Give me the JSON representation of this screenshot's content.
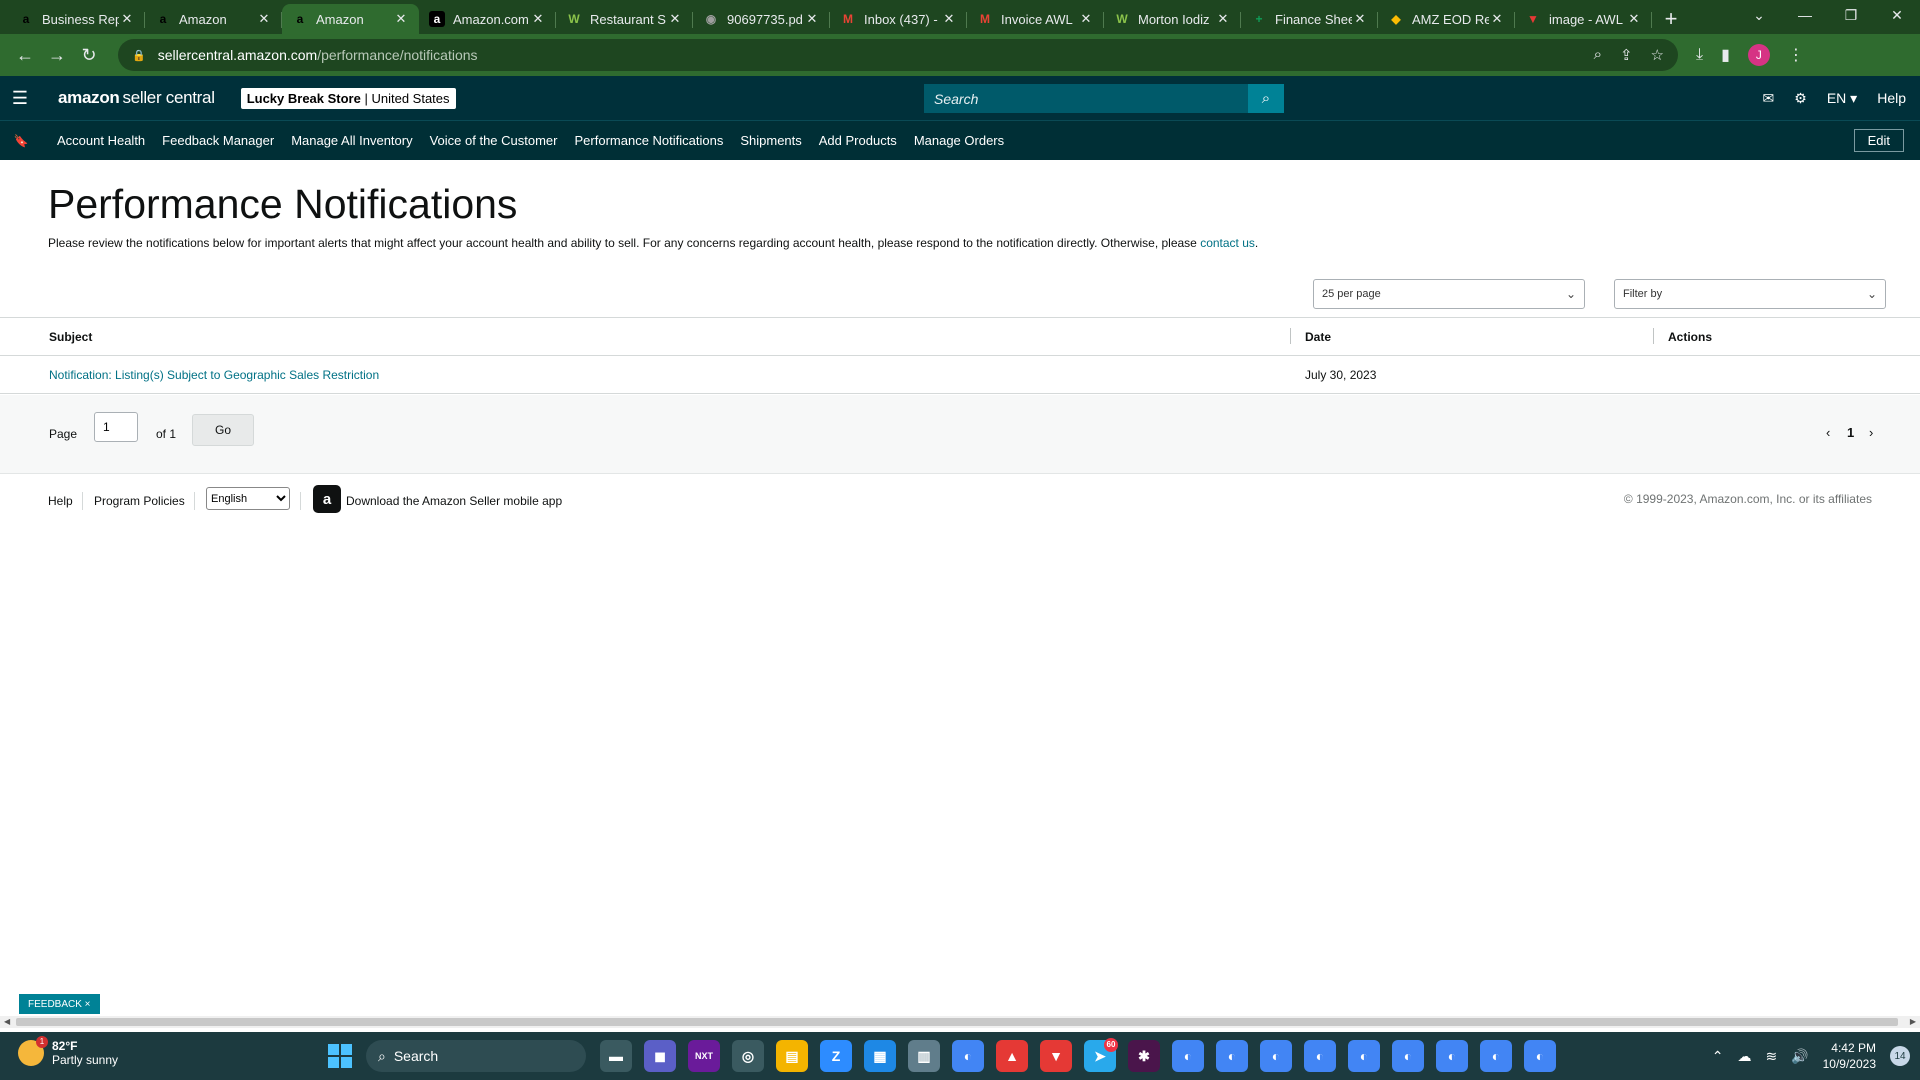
{
  "browser": {
    "tabs": [
      {
        "title": "Business Rep",
        "favicon": "a",
        "fav_color": "#000000",
        "active": false
      },
      {
        "title": "Amazon",
        "favicon": "a",
        "fav_color": "#000000",
        "active": false
      },
      {
        "title": "Amazon",
        "favicon": "a",
        "fav_color": "#000000",
        "active": true
      },
      {
        "title": "Amazon.com",
        "favicon": "a",
        "fav_color": "#ffffff",
        "active": false
      },
      {
        "title": "Restaurant S",
        "favicon": "W",
        "fav_color": "#8bc34a",
        "active": false
      },
      {
        "title": "90697735.pd",
        "favicon": "◉",
        "fav_color": "#9e9e9e",
        "active": false
      },
      {
        "title": "Inbox (437) -",
        "favicon": "M",
        "fav_color": "#ea4335",
        "active": false
      },
      {
        "title": "Invoice AWL",
        "favicon": "M",
        "fav_color": "#ea4335",
        "active": false
      },
      {
        "title": "Morton Iodiz",
        "favicon": "W",
        "fav_color": "#8bc34a",
        "active": false
      },
      {
        "title": "Finance Shee",
        "favicon": "+",
        "fav_color": "#0f9d58",
        "active": false
      },
      {
        "title": "AMZ EOD Re",
        "favicon": "◆",
        "fav_color": "#fbbc04",
        "active": false
      },
      {
        "title": "image - AWL",
        "favicon": "▼",
        "fav_color": "#e53935",
        "active": false
      }
    ],
    "url_host": "sellercentral.amazon.com",
    "url_path": "/performance/notifications",
    "theme_color": "#2f6b2f",
    "avatar_letter": "J"
  },
  "header": {
    "logo_amazon": "amazon",
    "logo_suffix": "seller central",
    "store_name": "Lucky Break Store",
    "store_sep": " | ",
    "store_region": "United States",
    "search_placeholder": "Search",
    "language": "EN ▾",
    "help": "Help"
  },
  "nav": {
    "items": [
      "Account Health",
      "Feedback Manager",
      "Manage All Inventory",
      "Voice of the Customer",
      "Performance Notifications",
      "Shipments",
      "Add Products",
      "Manage Orders"
    ],
    "edit_label": "Edit"
  },
  "page": {
    "title": "Performance Notifications",
    "description": "Please review the notifications below for important alerts that might affect your account health and ability to sell. For any concerns regarding account health, please respond to the notification directly. Otherwise, please ",
    "contact_link": "contact us",
    "description_end": ".",
    "per_page": "25 per page",
    "filter_by": "Filter by",
    "table": {
      "headers": {
        "subject": "Subject",
        "date": "Date",
        "actions": "Actions"
      },
      "rows": [
        {
          "subject": "Notification: Listing(s) Subject to Geographic Sales Restriction",
          "date": "July 30, 2023"
        }
      ]
    },
    "pager": {
      "page_label": "Page",
      "page_value": "1",
      "of_label": "of 1",
      "go_label": "Go",
      "prev": "‹",
      "current": "1",
      "next": "›"
    }
  },
  "footer": {
    "help": "Help",
    "program_policies": "Program Policies",
    "language": "English",
    "app_text": "Download the Amazon Seller mobile app",
    "copyright": "© 1999-2023, Amazon.com, Inc. or its affiliates"
  },
  "feedback": {
    "label": "FEEDBACK ×"
  },
  "taskbar": {
    "temp": "82°F",
    "weather": "Partly sunny",
    "weather_badge": "1",
    "search_label": "Search",
    "time": "4:42 PM",
    "date": "10/9/2023",
    "notifications": "14",
    "apps": [
      {
        "label": "▬",
        "color": "#3a5a60"
      },
      {
        "label": "◼",
        "color": "#5b5fc7"
      },
      {
        "label": "NXT",
        "color": "#6a1b9a"
      },
      {
        "label": "◎",
        "color": "#3a5a60"
      },
      {
        "label": "▤",
        "color": "#f4b400"
      },
      {
        "label": "Z",
        "color": "#2d8cff"
      },
      {
        "label": "▦",
        "color": "#1e88e5"
      },
      {
        "label": "▥",
        "color": "#607d8b"
      },
      {
        "label": "◐",
        "color": "#4285f4"
      },
      {
        "label": "▲",
        "color": "#e53935"
      },
      {
        "label": "▼",
        "color": "#e53935"
      },
      {
        "label": "➤",
        "color": "#29a9eb",
        "badge": "60"
      },
      {
        "label": "✱",
        "color": "#4a154b"
      },
      {
        "label": "◐",
        "color": "#4285f4"
      },
      {
        "label": "◐",
        "color": "#4285f4"
      },
      {
        "label": "◐",
        "color": "#4285f4"
      },
      {
        "label": "◐",
        "color": "#4285f4"
      },
      {
        "label": "◐",
        "color": "#4285f4"
      },
      {
        "label": "◐",
        "color": "#4285f4"
      },
      {
        "label": "◐",
        "color": "#4285f4"
      },
      {
        "label": "◐",
        "color": "#4285f4"
      },
      {
        "label": "◐",
        "color": "#4285f4"
      }
    ]
  }
}
